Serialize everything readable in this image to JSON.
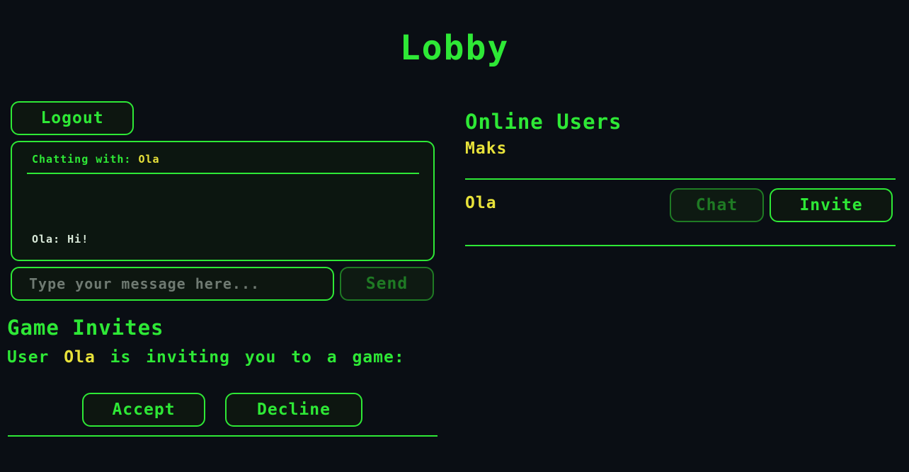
{
  "page": {
    "title": "Lobby"
  },
  "chat": {
    "logout_label": "Logout",
    "header_prefix": "Chatting with:",
    "partner": "Ola",
    "messages": [
      {
        "text": "Ola: Hi!"
      }
    ],
    "input_placeholder": "Type your message here...",
    "send_label": "Send"
  },
  "invites": {
    "heading": "Game Invites",
    "text_prefix": "User",
    "from_user": "Ola",
    "text_suffix": "is inviting you to a game:",
    "accept_label": "Accept",
    "decline_label": "Decline"
  },
  "online": {
    "heading": "Online Users",
    "current_user": "Maks",
    "users": [
      {
        "name": "Ola",
        "chat_label": "Chat",
        "invite_label": "Invite"
      }
    ]
  },
  "colors": {
    "background": "#0a0e14",
    "accent": "#2ee836",
    "highlight": "#e8e23a",
    "disabled": "#1f7a24"
  }
}
